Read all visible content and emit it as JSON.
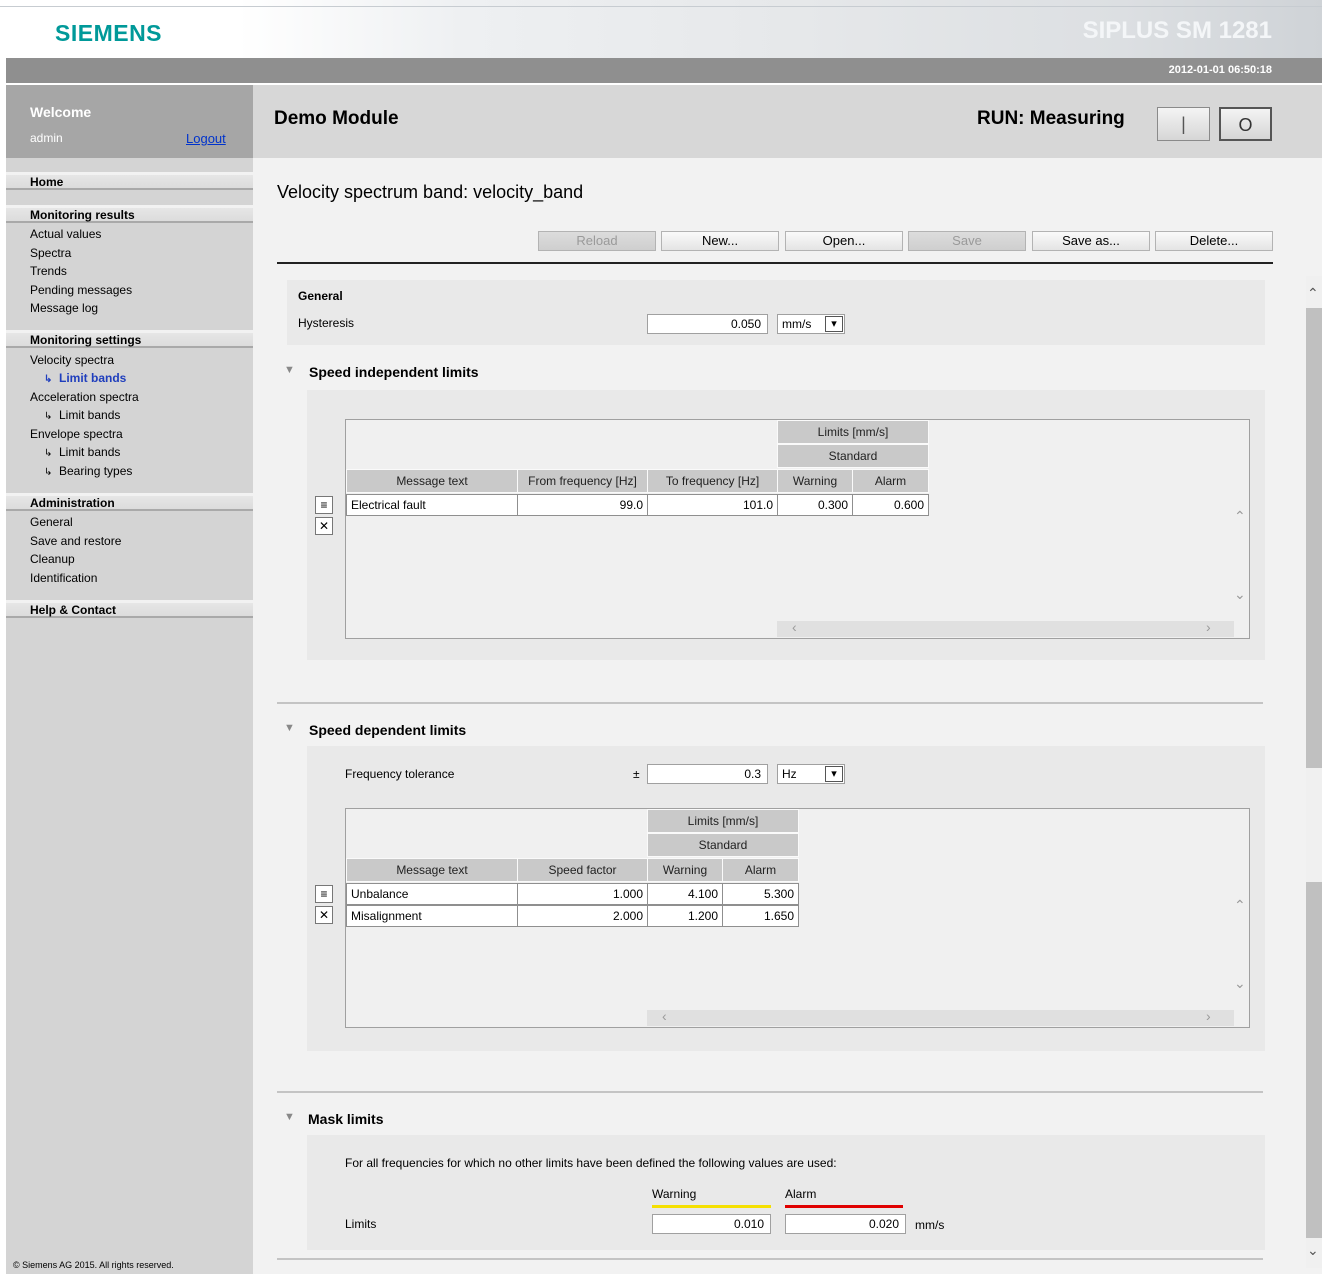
{
  "header": {
    "logo": "SIEMENS",
    "product": "SIPLUS SM 1281",
    "datetime": "2012-01-01 06:50:18",
    "brand_color": "#009999"
  },
  "sidebar": {
    "welcome": "Welcome",
    "username": "admin",
    "logout": "Logout",
    "home": "Home",
    "monitoring_results": {
      "title": "Monitoring results",
      "items": [
        "Actual values",
        "Spectra",
        "Trends",
        "Pending messages",
        "Message log"
      ]
    },
    "monitoring_settings": {
      "title": "Monitoring settings",
      "velocity_spectra": "Velocity spectra",
      "velocity_limit_bands": "Limit bands",
      "acceleration_spectra": "Acceleration spectra",
      "acceleration_limit_bands": "Limit bands",
      "envelope_spectra": "Envelope spectra",
      "envelope_limit_bands": "Limit bands",
      "bearing_types": "Bearing types"
    },
    "administration": {
      "title": "Administration",
      "items": [
        "General",
        "Save and restore",
        "Cleanup",
        "Identification"
      ]
    },
    "help": "Help & Contact",
    "copyright": "© Siemens AG 2015. All rights reserved."
  },
  "main": {
    "module_title": "Demo Module",
    "run_status": "RUN: Measuring",
    "run_button": "|",
    "stop_button": "O",
    "page_title": "Velocity spectrum band: velocity_band",
    "toolbar": {
      "reload": "Reload",
      "new": "New...",
      "open": "Open...",
      "save": "Save",
      "save_as": "Save as...",
      "delete": "Delete..."
    },
    "general": {
      "title": "General",
      "hysteresis_label": "Hysteresis",
      "hysteresis_value": "0.050",
      "hysteresis_unit": "mm/s"
    },
    "speed_independent": {
      "title": "Speed independent limits",
      "limits_header": "Limits [mm/s]",
      "standard_header": "Standard",
      "columns": [
        "Message text",
        "From frequency [Hz]",
        "To frequency [Hz]",
        "Warning",
        "Alarm"
      ],
      "rows": [
        [
          "Electrical fault",
          "99.0",
          "101.0",
          "0.300",
          "0.600"
        ]
      ]
    },
    "speed_dependent": {
      "title": "Speed dependent limits",
      "freq_tol_label": "Frequency tolerance",
      "plusminus": "±",
      "freq_tol_value": "0.3",
      "freq_tol_unit": "Hz",
      "limits_header": "Limits [mm/s]",
      "standard_header": "Standard",
      "columns": [
        "Message text",
        "Speed factor",
        "Warning",
        "Alarm"
      ],
      "rows": [
        [
          "Unbalance",
          "1.000",
          "4.100",
          "5.300"
        ],
        [
          "Misalignment",
          "2.000",
          "1.200",
          "1.650"
        ]
      ]
    },
    "mask_limits": {
      "title": "Mask limits",
      "description": "For all frequencies for which no other limits have been defined the following values are used:",
      "warning_label": "Warning",
      "alarm_label": "Alarm",
      "limits_label": "Limits",
      "warning_value": "0.010",
      "alarm_value": "0.020",
      "unit": "mm/s",
      "warning_color": "#f5e000",
      "alarm_color": "#e00000"
    }
  }
}
